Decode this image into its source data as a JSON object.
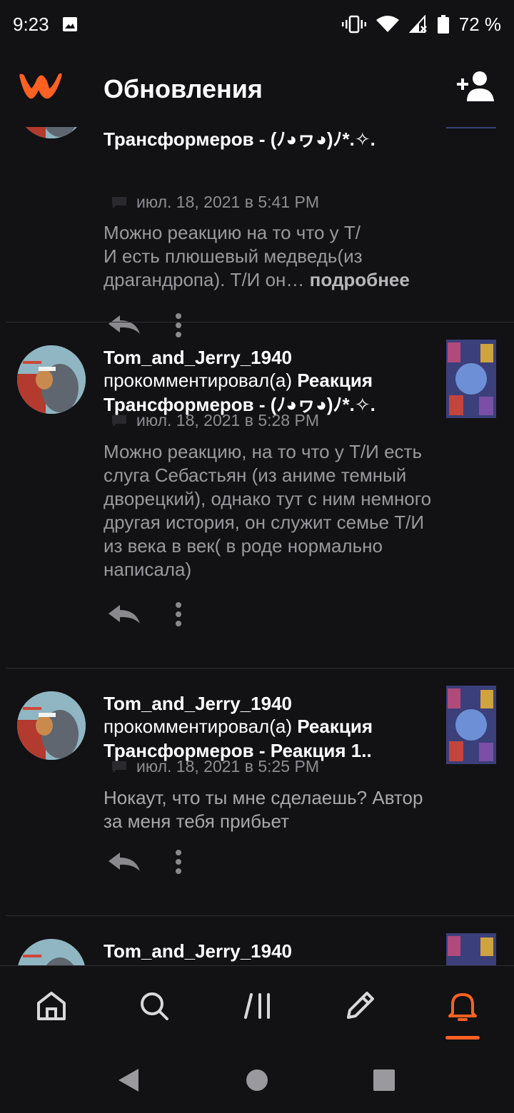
{
  "status_bar": {
    "time": "9:23",
    "battery": "72 %"
  },
  "app_bar": {
    "title": "Обновления"
  },
  "items": [
    {
      "headline_tail": "Трансформеров - (ﾉ◕ヮ◕)ﾉ*.✧.",
      "timestamp": "июл. 18, 2021 в 5:41 PM",
      "body": "Можно реакцию на то что у Т/\nИ есть плюшевый медведь(из драгандропа). Т/И он…",
      "more": "подробнее"
    },
    {
      "user": "Tom_and_Jerry_1940",
      "action": "прокомментировал(а)",
      "story": "Реакция Трансформеров - (ﾉ◕ヮ◕)ﾉ*.✧.",
      "timestamp": "июл. 18, 2021 в 5:28 PM",
      "body": "Можно реакцию, на то что у Т/И есть слуга Себастьян (из аниме темный дворецкий), однако тут с ним немного другая история, он служит семье Т/И из века в век( в роде нормально написала)"
    },
    {
      "user": "Tom_and_Jerry_1940",
      "action": "прокомментировал(а)",
      "story": "Реакция Трансформеров - Реакция 1..",
      "timestamp": "июл. 18, 2021 в 5:25 PM",
      "body": "Нокаут, что ты мне сделаешь? Автор за меня тебя прибьет"
    },
    {
      "user": "Tom_and_Jerry_1940"
    }
  ],
  "bottom_nav": {
    "items": [
      {
        "icon": "home-icon"
      },
      {
        "icon": "search-icon"
      },
      {
        "icon": "library-icon"
      },
      {
        "icon": "write-icon"
      },
      {
        "icon": "bell-icon",
        "active": true
      }
    ]
  },
  "colors": {
    "accent": "#ff6122",
    "background": "#121114",
    "muted_text": "#9a999d",
    "meta_text": "#8e8d92"
  }
}
